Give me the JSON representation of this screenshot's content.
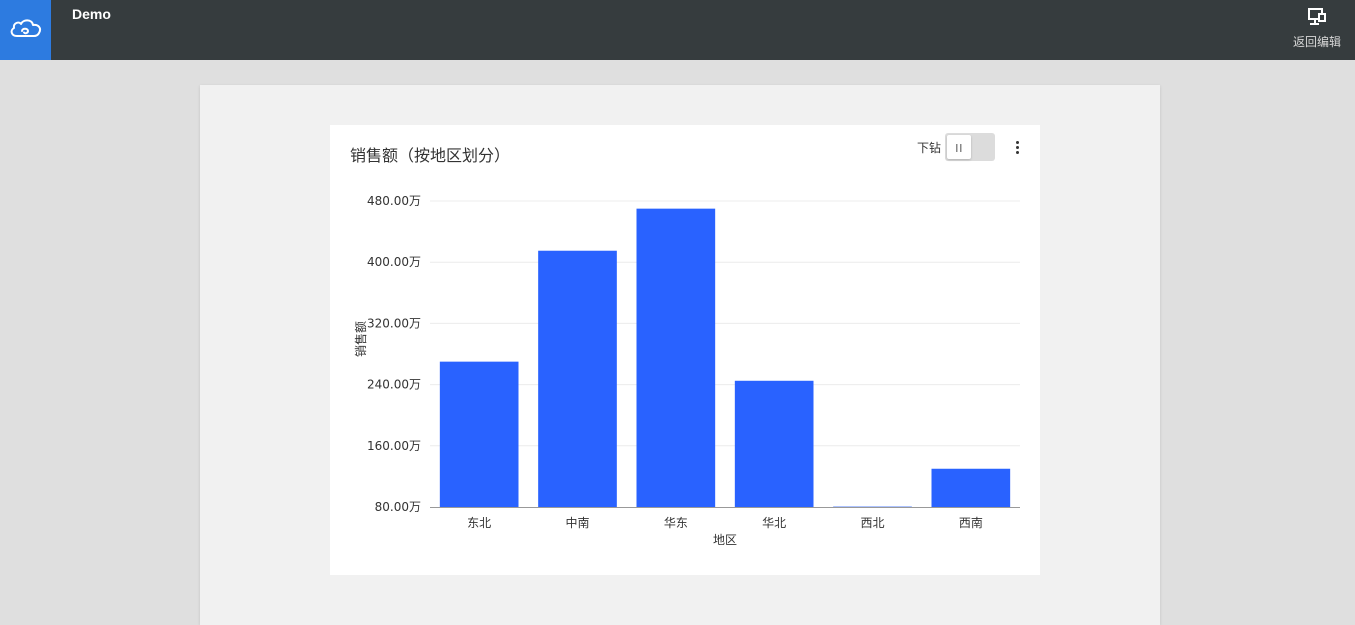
{
  "app": {
    "title": "Demo",
    "back_edit_label": "返回编辑"
  },
  "icons": {
    "logo": "cloud-icon",
    "back_edit": "monitor-icon",
    "more": "more-vertical-icon"
  },
  "colors": {
    "accent": "#2d7be0",
    "bar": "#2962ff",
    "topbar": "#363c3e"
  },
  "card": {
    "drill_label": "下钻"
  },
  "chart_data": {
    "type": "bar",
    "title": "销售额（按地区划分）",
    "xlabel": "地区",
    "ylabel": "销售额",
    "categories": [
      "东北",
      "中南",
      "华东",
      "华北",
      "西北",
      "西南"
    ],
    "values": [
      270,
      415,
      470,
      245,
      80.5,
      130
    ],
    "unit": "万",
    "ylim": [
      80,
      480
    ],
    "yticks": [
      80,
      160,
      240,
      320,
      400,
      480
    ],
    "ytick_labels": [
      "80.00万",
      "160.00万",
      "240.00万",
      "320.00万",
      "400.00万",
      "480.00万"
    ],
    "grid": true,
    "legend": "none"
  }
}
